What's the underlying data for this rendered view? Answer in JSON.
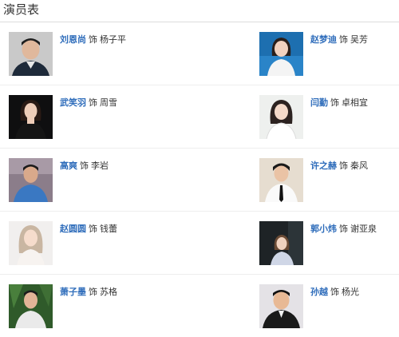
{
  "header": {
    "title": "演员表"
  },
  "cast": [
    [
      {
        "actor": "刘恩尚",
        "role_word": "饰",
        "role": "杨子平",
        "photo": "actor-photo-male-dark-hair"
      },
      {
        "actor": "赵梦迪",
        "role_word": "饰",
        "role": "吴芳",
        "photo": "actor-photo-female-blue"
      }
    ],
    [
      {
        "actor": "武笑羽",
        "role_word": "饰",
        "role": "周雪",
        "photo": "actor-photo-female-black-dress"
      },
      {
        "actor": "闫勤",
        "role_word": "饰",
        "role": "卓相宜",
        "photo": "actor-photo-female-white"
      }
    ],
    [
      {
        "actor": "高爽",
        "role_word": "饰",
        "role": "李岩",
        "photo": "actor-photo-male-blue-shirt"
      },
      {
        "actor": "许之赫",
        "role_word": "饰",
        "role": "秦风",
        "photo": "actor-photo-male-white-shirt-tie"
      }
    ],
    [
      {
        "actor": "赵圆圆",
        "role_word": "饰",
        "role": "钱蕾",
        "photo": "actor-photo-female-light-hair"
      },
      {
        "actor": "郭小炜",
        "role_word": "饰",
        "role": "谢亚泉",
        "photo": "actor-photo-female-dark-bg"
      }
    ],
    [
      {
        "actor": "萧子墨",
        "role_word": "饰",
        "role": "苏格",
        "photo": "actor-photo-male-greenery"
      },
      {
        "actor": "孙越",
        "role_word": "饰",
        "role": "杨光",
        "photo": "actor-photo-male-dark-suit"
      }
    ]
  ],
  "colors": {
    "link": "#2f6dbb",
    "text": "#333333",
    "divider": "#eeeeee"
  }
}
